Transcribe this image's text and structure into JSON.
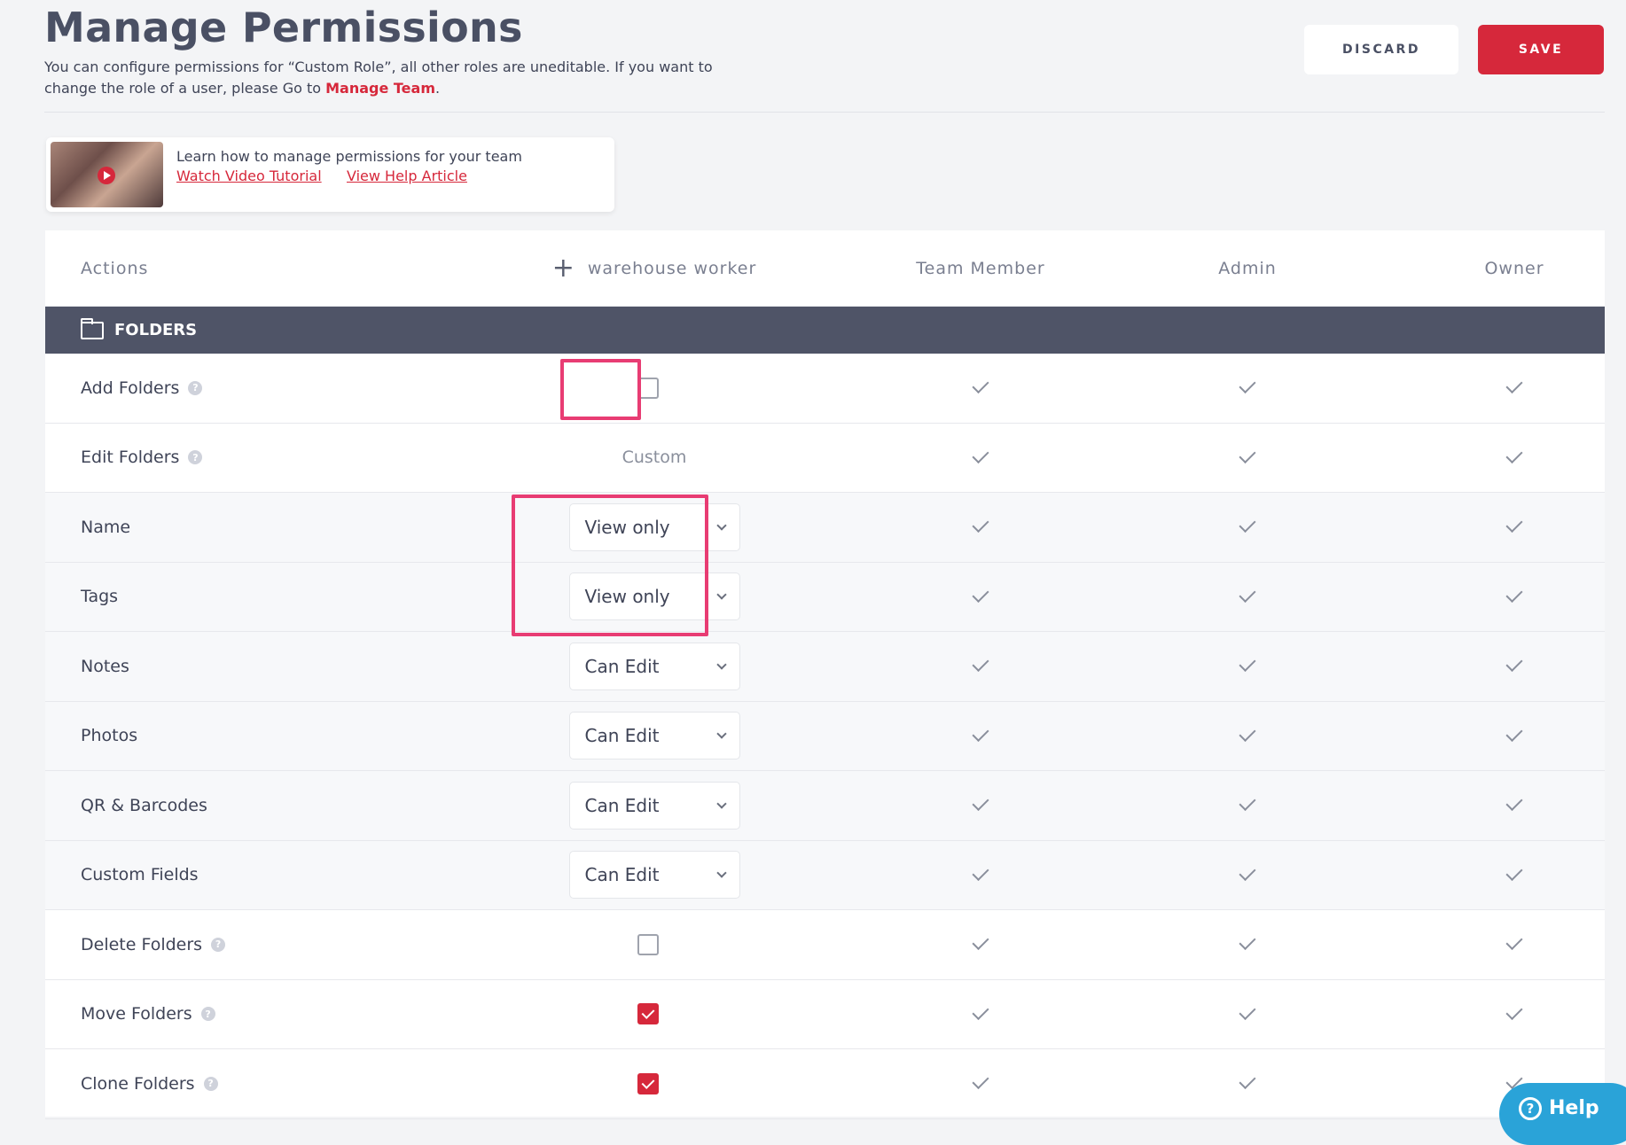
{
  "header": {
    "title": "Manage Permissions",
    "desc_before": "You can configure permissions for “Custom Role”, all other roles are uneditable. If you want to change the role of a user, please Go to ",
    "desc_link": "Manage Team",
    "desc_after": ".",
    "discard_label": "DISCARD",
    "save_label": "SAVE"
  },
  "tutorial": {
    "title": "Learn how to manage permissions for your team",
    "video_link": "Watch Video Tutorial",
    "article_link": "View Help Article"
  },
  "table": {
    "columns": {
      "actions": "Actions",
      "custom": "warehouse worker",
      "c2": "Team Member",
      "c3": "Admin",
      "c4": "Owner"
    },
    "section": "FOLDERS",
    "rows": [
      {
        "label": "Add Folders",
        "custom_type": "checkbox",
        "checked": false,
        "help": true
      },
      {
        "label": "Edit Folders",
        "custom_type": "text",
        "value": "Custom",
        "help": true
      },
      {
        "label": "Name",
        "custom_type": "select",
        "value": "View only"
      },
      {
        "label": "Tags",
        "custom_type": "select",
        "value": "View only"
      },
      {
        "label": "Notes",
        "custom_type": "select",
        "value": "Can Edit"
      },
      {
        "label": "Photos",
        "custom_type": "select",
        "value": "Can Edit"
      },
      {
        "label": "QR & Barcodes",
        "custom_type": "select",
        "value": "Can Edit"
      },
      {
        "label": "Custom Fields",
        "custom_type": "select",
        "value": "Can Edit"
      },
      {
        "label": "Delete Folders",
        "custom_type": "checkbox",
        "checked": false,
        "help": true
      },
      {
        "label": "Move Folders",
        "custom_type": "checkbox",
        "checked": true,
        "help": true
      },
      {
        "label": "Clone Folders",
        "custom_type": "checkbox",
        "checked": true,
        "help": true
      }
    ]
  },
  "help_widget": {
    "label": "Help"
  },
  "colors": {
    "accent": "#d6283b",
    "section_bg": "#4f5467",
    "highlight": "#e83c73",
    "help_bg": "#2aa3d8"
  },
  "icons": {
    "add_column": "plus-icon",
    "section": "folder-icon",
    "help": "question-icon",
    "granted": "check-icon",
    "dropdown": "chevron-down-icon"
  }
}
